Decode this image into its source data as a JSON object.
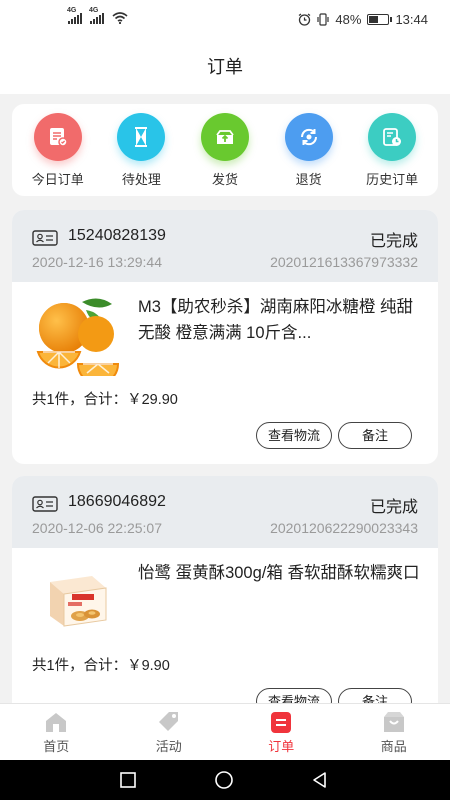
{
  "status_bar": {
    "network_1": "4G",
    "network_2": "4G",
    "battery": "48%",
    "battery_level": 0.48,
    "time": "13:44"
  },
  "header": {
    "title": "订单"
  },
  "categories": [
    {
      "label": "今日订单",
      "icon": "receipt-icon",
      "color": "#f16b6b"
    },
    {
      "label": "待处理",
      "icon": "hourglass-icon",
      "color": "#29c4e8"
    },
    {
      "label": "发货",
      "icon": "shipping-box-icon",
      "color": "#69c92f"
    },
    {
      "label": "退货",
      "icon": "return-icon",
      "color": "#4d9df0"
    },
    {
      "label": "历史订单",
      "icon": "history-icon",
      "color": "#3ccdc2"
    }
  ],
  "orders": [
    {
      "phone": "15240828139",
      "status": "已完成",
      "date": "2020-12-16 13:29:44",
      "order_no": "2020121613367973332",
      "product_title": "M3【助农秒杀】湖南麻阳冰糖橙 纯甜无酸 橙意满满 10斤含...",
      "product_image": "orange-image",
      "total": "共1件，合计：￥29.90",
      "logistics_label": "查看物流",
      "remark_label": "备注"
    },
    {
      "phone": "18669046892",
      "status": "已完成",
      "date": "2020-12-06 22:25:07",
      "order_no": "2020120622290023343",
      "product_title": "怡鹭 蛋黄酥300g/箱 香软甜酥软糯爽口",
      "product_image": "pastry-box-image",
      "total": "共1件，合计：￥9.90",
      "logistics_label": "查看物流",
      "remark_label": "备注"
    }
  ],
  "tabs": [
    {
      "label": "首页",
      "icon": "home-icon"
    },
    {
      "label": "活动",
      "icon": "tag-icon"
    },
    {
      "label": "订单",
      "icon": "order-icon",
      "active": true
    },
    {
      "label": "商品",
      "icon": "goods-icon"
    }
  ],
  "colors": {
    "accent": "#f0343c",
    "card_head": "#e9ecef",
    "muted_text": "#9a9a9a"
  }
}
